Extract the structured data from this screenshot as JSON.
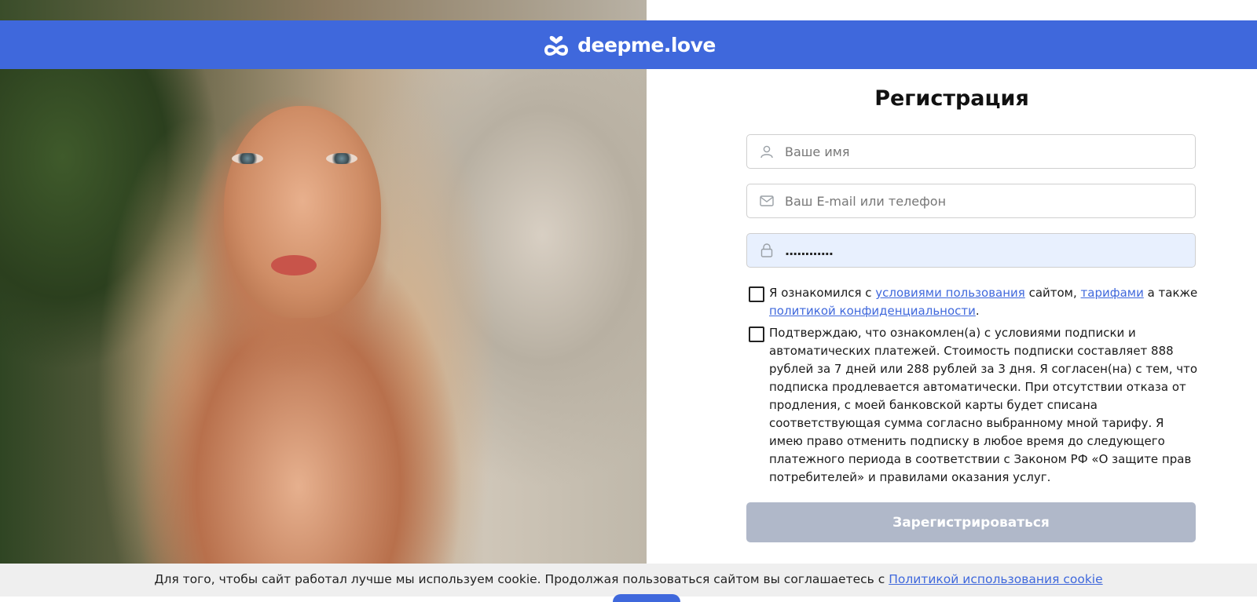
{
  "brand": {
    "name": "deepme.love",
    "header_color": "#3f68dc"
  },
  "form": {
    "title": "Регистрация",
    "name_placeholder": "Ваше имя",
    "contact_placeholder": "Ваш E-mail или телефон",
    "password_value": "............",
    "consent1": {
      "prefix": "Я ознакомился с ",
      "terms_link": "условиями пользования",
      "mid": " сайтом, ",
      "tariffs_link": "тарифами",
      "mid2": " а также ",
      "privacy_link": "политикой конфиденциальности",
      "suffix": "."
    },
    "consent2": "Подтверждаю, что ознакомлен(а) с условиями подписки и автоматических платежей. Стоимость подписки составляет 888 рублей за 7 дней или 288 рублей за 3 дня. Я согласен(на) с тем, что подписка продлевается автоматически. При отсутствии отказа от продления, с моей банковской карты будет списана соответствующая сумма согласно выбранному мной тарифу. Я имею право отменить подписку в любое время до следующего платежного периода в соответствии с Законом РФ «О защите прав потребителей» и правилами оказания услуг.",
    "submit_label": "Зарегистрироваться"
  },
  "cookie": {
    "text": "Для того, чтобы сайт работал лучше мы используем cookie. Продолжая пользоваться сайтом вы соглашаетесь с ",
    "link": "Политикой использования cookie"
  },
  "icons": [
    "infinity-heart-logo-icon",
    "user-icon",
    "envelope-icon",
    "lock-icon"
  ]
}
